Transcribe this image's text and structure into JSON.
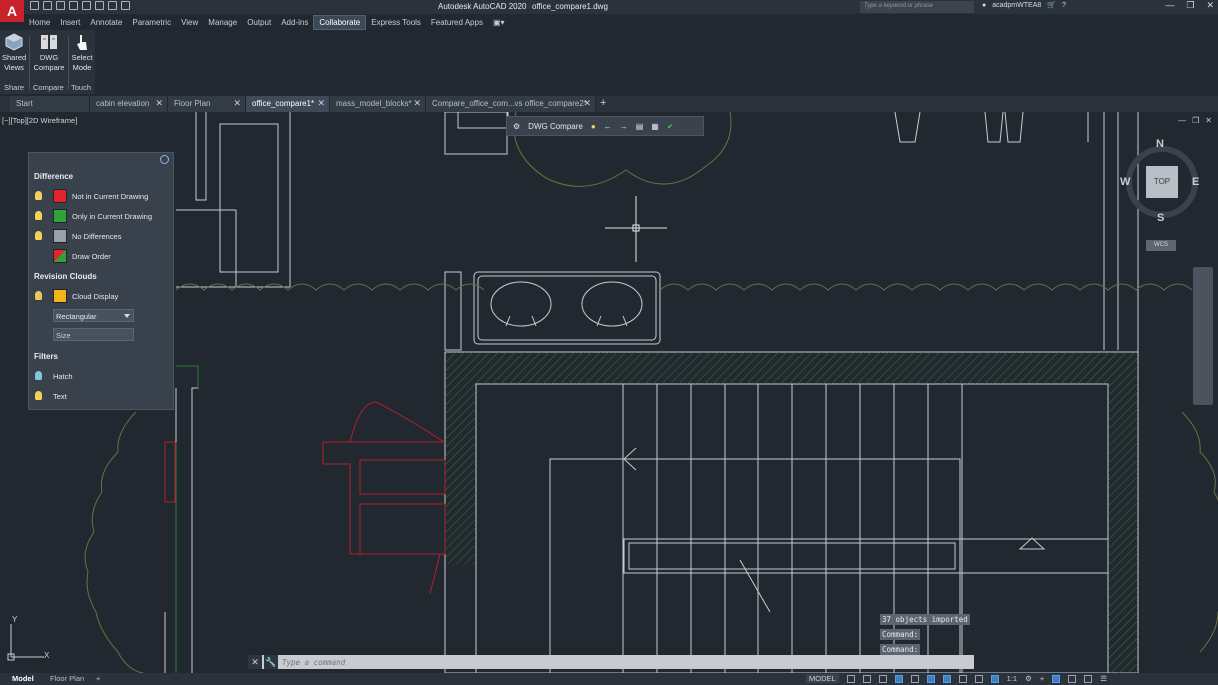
{
  "app": {
    "title": "Autodesk AutoCAD 2020",
    "filename": "office_compare1.dwg",
    "logo": "A",
    "search_placeholder": "Type a keyword or phrase",
    "username": "acadpmWTEA8"
  },
  "ribbon": {
    "tabs": [
      "Home",
      "Insert",
      "Annotate",
      "Parametric",
      "View",
      "Manage",
      "Output",
      "Add-ins",
      "Collaborate",
      "Express Tools",
      "Featured Apps"
    ],
    "active_tab": "Collaborate",
    "buttons": [
      {
        "label1": "Shared",
        "label2": "Views",
        "icon": "shared-views-icon"
      },
      {
        "label1": "DWG",
        "label2": "Compare",
        "icon": "dwg-compare-icon"
      },
      {
        "label1": "Select",
        "label2": "Mode",
        "icon": "select-mode-icon"
      }
    ],
    "panels": [
      "Share",
      "Compare",
      "Touch"
    ]
  },
  "doc_tabs": [
    {
      "label": "Start",
      "closable": false,
      "active": false
    },
    {
      "label": "cabin elevation",
      "closable": true,
      "active": false
    },
    {
      "label": "Floor Plan",
      "closable": true,
      "active": false
    },
    {
      "label": "office_compare1*",
      "closable": true,
      "active": true
    },
    {
      "label": "mass_model_blocks*",
      "closable": true,
      "active": false
    },
    {
      "label": "Compare_office_com...vs office_compare2*",
      "closable": true,
      "active": false
    }
  ],
  "viewport": {
    "label": "[−][Top][2D Wireframe]"
  },
  "compare_toolbar": {
    "label": "DWG Compare"
  },
  "compare_panel": {
    "difference_header": "Difference",
    "difference_items": [
      {
        "label": "Not in Current Drawing",
        "color": "#e0252b"
      },
      {
        "label": "Only in Current Drawing",
        "color": "#2fa33a"
      },
      {
        "label": "No Differences",
        "color": "#9aa0a6"
      },
      {
        "label": "Draw Order",
        "color": "#2fa33a"
      }
    ],
    "revision_header": "Revision Clouds",
    "cloud_display_label": "Cloud Display",
    "cloud_color": "#f2b51e",
    "shape_value": "Rectangular",
    "size_placeholder": "Size",
    "filters_header": "Filters",
    "filter_items": [
      "Hatch",
      "Text"
    ]
  },
  "viewcube": {
    "north": "N",
    "south": "S",
    "east": "E",
    "west": "W",
    "face": "TOP",
    "wcs": "WCS"
  },
  "command_history": [
    "37 objects imported",
    "Command:",
    "Command:"
  ],
  "command_prompt": "Type a command",
  "layout_tabs": [
    "Model",
    "Floor Plan"
  ],
  "active_layout": "Model",
  "status": {
    "mode": "MODEL",
    "scale": "1:1"
  },
  "colors": {
    "canvas_bg": "#212830",
    "linework": "#c6ccd2",
    "red_diff": "#b3212a",
    "green_diff": "#2b7a34",
    "tree": "#6e7040"
  }
}
